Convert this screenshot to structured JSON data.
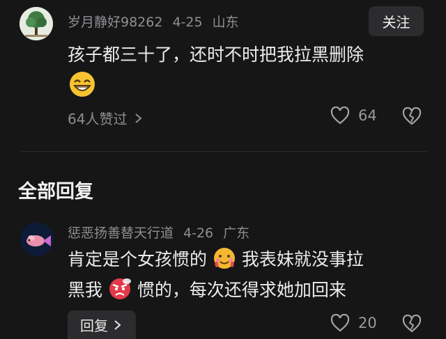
{
  "comment": {
    "username": "岁月静好98262",
    "date": "4-25",
    "location": "山东",
    "follow_label": "关注",
    "text_line1": "孩子都三十了，还时不时把我拉黑删除",
    "likes_text": "64人赞过",
    "like_count": "64"
  },
  "replies_section": {
    "title": "全部回复"
  },
  "reply": {
    "username": "惩恶扬善替天行道",
    "date": "4-26",
    "location": "广东",
    "text_part1": "肯定是个女孩惯的",
    "text_part2": "我表妹就没事拉",
    "text_part3": "黑我",
    "text_part4": "惯的，每次还得求她加回来",
    "reply_label": "回复",
    "like_count": "20"
  },
  "icons": [
    "chevron-right-icon",
    "heart-icon",
    "broken-heart-icon",
    "grin-emoji",
    "smiling-tear-emoji",
    "angry-emoji"
  ]
}
